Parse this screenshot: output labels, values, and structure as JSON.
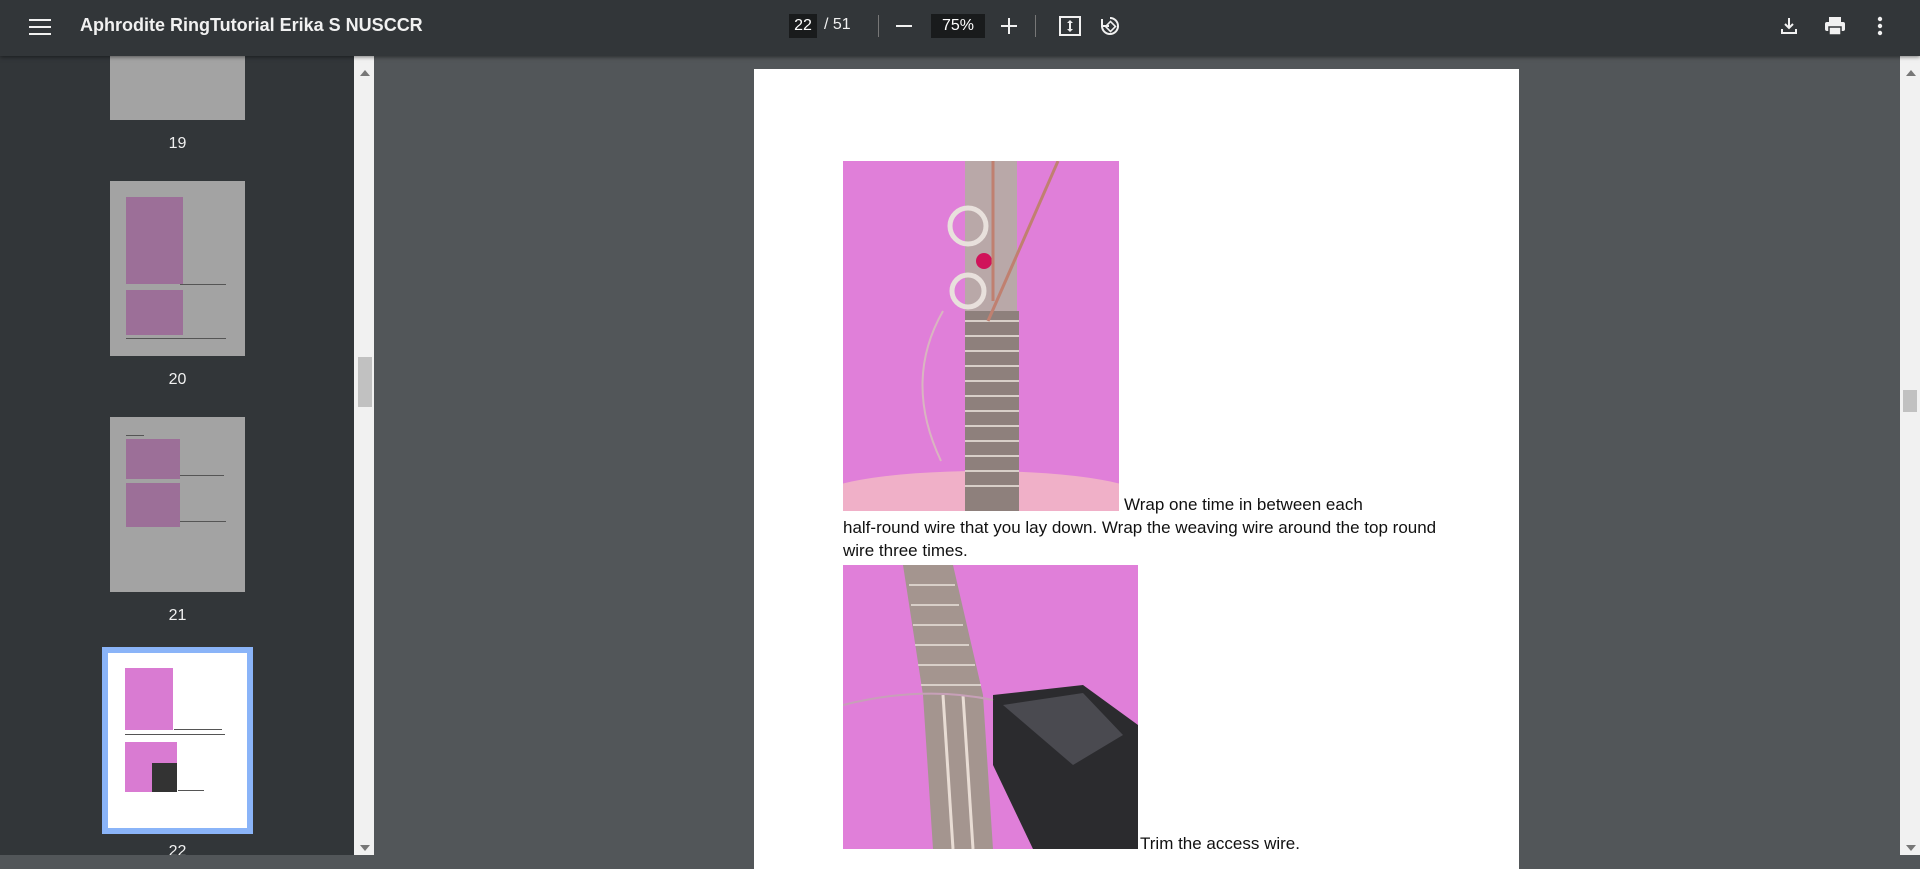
{
  "toolbar": {
    "title": "Aphrodite RingTutorial Erika S NUSCCR",
    "current_page": "22",
    "total_pages": "/  51",
    "zoom": "75%",
    "icons": [
      "menu-icon",
      "zoom-out-icon",
      "zoom-in-icon",
      "fit-page-icon",
      "rotate-icon",
      "download-icon",
      "print-icon",
      "more-icon"
    ]
  },
  "sidebar": {
    "thumbnails": [
      {
        "label": "19"
      },
      {
        "label": "20"
      },
      {
        "label": "21"
      },
      {
        "label": "22"
      }
    ]
  },
  "document": {
    "caption1_start": "Wrap one time in between each",
    "caption1_rest": "half-round wire that you lay down. Wrap the weaving wire around the top round wire three times.",
    "caption2": "Trim the access wire."
  },
  "colors": {
    "toolbar": "#323639",
    "background": "#525659",
    "selection": "#8ab4f8",
    "photo_bg": "#e07fd9"
  }
}
